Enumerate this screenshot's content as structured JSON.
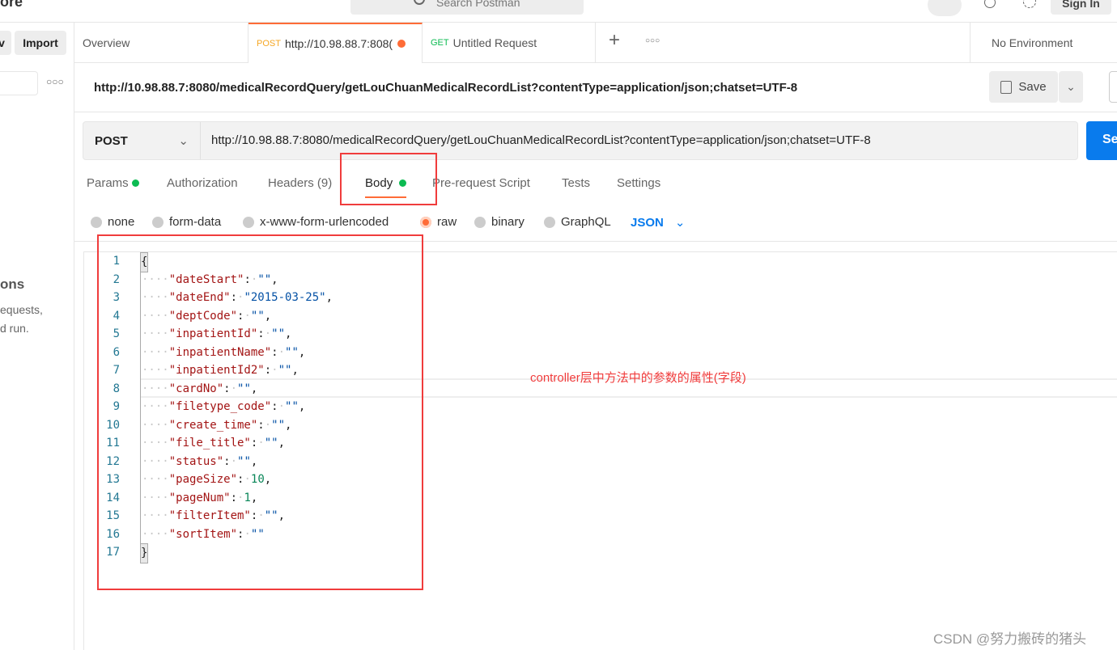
{
  "topbar": {
    "partial_title": "ore",
    "search_placeholder": "Search Postman",
    "signin": "Sign In"
  },
  "sidebar": {
    "new_partial": "v",
    "import": "Import",
    "heading_partial": "ons",
    "text1": "equests,",
    "text2": "d run."
  },
  "tabs": [
    {
      "label": "Overview"
    },
    {
      "method": "POST",
      "label": "http://10.98.88.7:808(",
      "unsaved": true,
      "active": true
    },
    {
      "method": "GET",
      "label": "Untitled Request"
    }
  ],
  "environment": "No Environment",
  "request_title": "http://10.98.88.7:8080/medicalRecordQuery/getLouChuanMedicalRecordList?contentType=application/json;chatset=UTF-8",
  "save_label": "Save",
  "method": "POST",
  "url": "http://10.98.88.7:8080/medicalRecordQuery/getLouChuanMedicalRecordList?contentType=application/json;chatset=UTF-8",
  "send_partial": "Se",
  "request_tabs": [
    {
      "label": "Params",
      "dot": true
    },
    {
      "label": "Authorization"
    },
    {
      "label": "Headers",
      "count": "(9)"
    },
    {
      "label": "Body",
      "dot": true,
      "active": true
    },
    {
      "label": "Pre-request Script"
    },
    {
      "label": "Tests"
    },
    {
      "label": "Settings"
    }
  ],
  "body_types": [
    {
      "label": "none"
    },
    {
      "label": "form-data"
    },
    {
      "label": "x-www-form-urlencoded"
    },
    {
      "label": "raw",
      "selected": true
    },
    {
      "label": "binary"
    },
    {
      "label": "GraphQL"
    }
  ],
  "body_format": "JSON",
  "code_lines": [
    {
      "n": "1",
      "open": "{"
    },
    {
      "n": "2",
      "key": "\"dateStart\"",
      "val": "\"\"",
      "type": "s",
      "comma": ","
    },
    {
      "n": "3",
      "key": "\"dateEnd\"",
      "val": "\"2015-03-25\"",
      "type": "s",
      "comma": ","
    },
    {
      "n": "4",
      "key": "\"deptCode\"",
      "val": "\"\"",
      "type": "s",
      "comma": ","
    },
    {
      "n": "5",
      "key": "\"inpatientId\"",
      "val": "\"\"",
      "type": "s",
      "comma": ","
    },
    {
      "n": "6",
      "key": "\"inpatientName\"",
      "val": "\"\"",
      "type": "s",
      "comma": ","
    },
    {
      "n": "7",
      "key": "\"inpatientId2\"",
      "val": "\"\"",
      "type": "s",
      "comma": ","
    },
    {
      "n": "8",
      "key": "\"cardNo\"",
      "val": "\"\"",
      "type": "s",
      "comma": ","
    },
    {
      "n": "9",
      "key": "\"filetype_code\"",
      "val": "\"\"",
      "type": "s",
      "comma": ","
    },
    {
      "n": "10",
      "key": "\"create_time\"",
      "val": "\"\"",
      "type": "s",
      "comma": ","
    },
    {
      "n": "11",
      "key": "\"file_title\"",
      "val": "\"\"",
      "type": "s",
      "comma": ","
    },
    {
      "n": "12",
      "key": "\"status\"",
      "val": "\"\"",
      "type": "s",
      "comma": ","
    },
    {
      "n": "13",
      "key": "\"pageSize\"",
      "val": "10",
      "type": "n",
      "comma": ","
    },
    {
      "n": "14",
      "key": "\"pageNum\"",
      "val": "1",
      "type": "n",
      "comma": ","
    },
    {
      "n": "15",
      "key": "\"filterItem\"",
      "val": "\"\"",
      "type": "s",
      "comma": ","
    },
    {
      "n": "16",
      "key": "\"sortItem\"",
      "val": "\"\"",
      "type": "s",
      "comma": ""
    },
    {
      "n": "17",
      "open": "}"
    }
  ],
  "annotation": "controller层中方法中的参数的属性(字段)",
  "watermark": "CSDN @努力搬砖的猪头",
  "colors": {
    "accent": "#ff6c37",
    "annotation": "#f03c3c",
    "send": "#097bed",
    "green": "#0cbb52"
  }
}
